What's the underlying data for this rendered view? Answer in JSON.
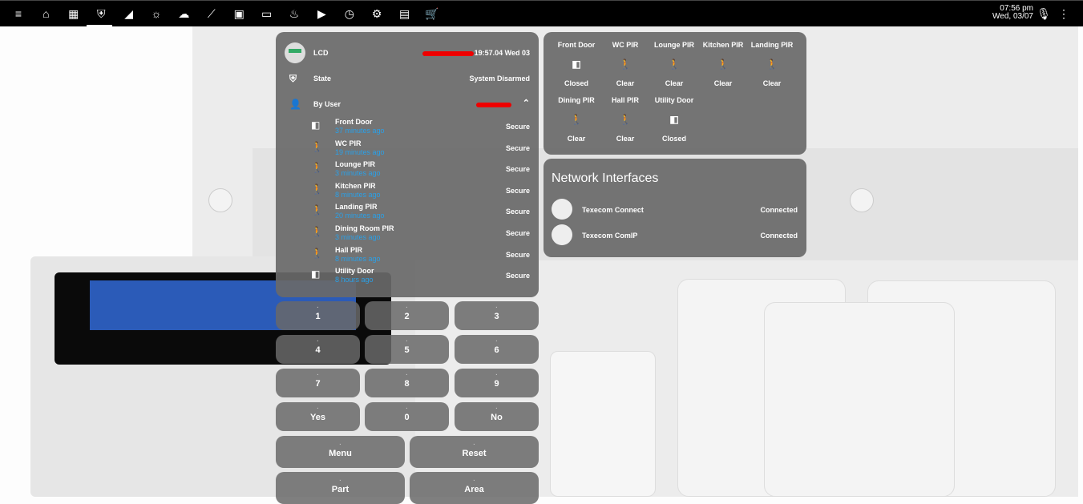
{
  "topbar": {
    "icons": [
      "menu-icon",
      "home-icon",
      "floorplan-icon",
      "alarm-shield-icon",
      "cctv-icon",
      "lightbulb-icon",
      "weather-icon",
      "chart-icon",
      "tv-icon",
      "media-player-icon",
      "heater-icon",
      "projector-icon",
      "car-clock-icon",
      "settings-icon",
      "calendar-icon",
      "cart-icon"
    ],
    "time": "07:56 pm",
    "date": "Wed, 03/07"
  },
  "alarm_card": {
    "lcd_label": "LCD",
    "lcd_value": "19:57.04 Wed 03",
    "state_label": "State",
    "state_value": "System Disarmed",
    "by_user_label": "By User",
    "zones": [
      {
        "name": "Front Door",
        "time": "37 minutes ago",
        "state": "Secure",
        "icon": "door"
      },
      {
        "name": "WC PIR",
        "time": "19 minutes ago",
        "state": "Secure",
        "icon": "walk"
      },
      {
        "name": "Lounge PIR",
        "time": "3 minutes ago",
        "state": "Secure",
        "icon": "walk"
      },
      {
        "name": "Kitchen PIR",
        "time": "8 minutes ago",
        "state": "Secure",
        "icon": "walk"
      },
      {
        "name": "Landing PIR",
        "time": "20 minutes ago",
        "state": "Secure",
        "icon": "walk"
      },
      {
        "name": "Dining Room PIR",
        "time": "3 minutes ago",
        "state": "Secure",
        "icon": "walk"
      },
      {
        "name": "Hall PIR",
        "time": "8 minutes ago",
        "state": "Secure",
        "icon": "walk"
      },
      {
        "name": "Utility Door",
        "time": "8 hours ago",
        "state": "Secure",
        "icon": "door"
      }
    ]
  },
  "sensors_card": {
    "tiles": [
      {
        "name": "Front Door",
        "state": "Closed",
        "icon": "door"
      },
      {
        "name": "WC PIR",
        "state": "Clear",
        "icon": "walk"
      },
      {
        "name": "Lounge PIR",
        "state": "Clear",
        "icon": "walk"
      },
      {
        "name": "Kitchen PIR",
        "state": "Clear",
        "icon": "walk"
      },
      {
        "name": "Landing PIR",
        "state": "Clear",
        "icon": "walk"
      },
      {
        "name": "Dining PIR",
        "state": "Clear",
        "icon": "walk"
      },
      {
        "name": "Hall PIR",
        "state": "Clear",
        "icon": "walk"
      },
      {
        "name": "Utility Door",
        "state": "Closed",
        "icon": "door"
      }
    ]
  },
  "network_card": {
    "title": "Network Interfaces",
    "items": [
      {
        "name": "Texecom Connect",
        "state": "Connected"
      },
      {
        "name": "Texecom ComIP",
        "state": "Connected"
      }
    ]
  },
  "keypad": {
    "keys": [
      "1",
      "2",
      "3",
      "4",
      "5",
      "6",
      "7",
      "8",
      "9",
      "Yes",
      "0",
      "No"
    ],
    "wide_keys": [
      "Menu",
      "Reset",
      "Part",
      "Area"
    ]
  }
}
